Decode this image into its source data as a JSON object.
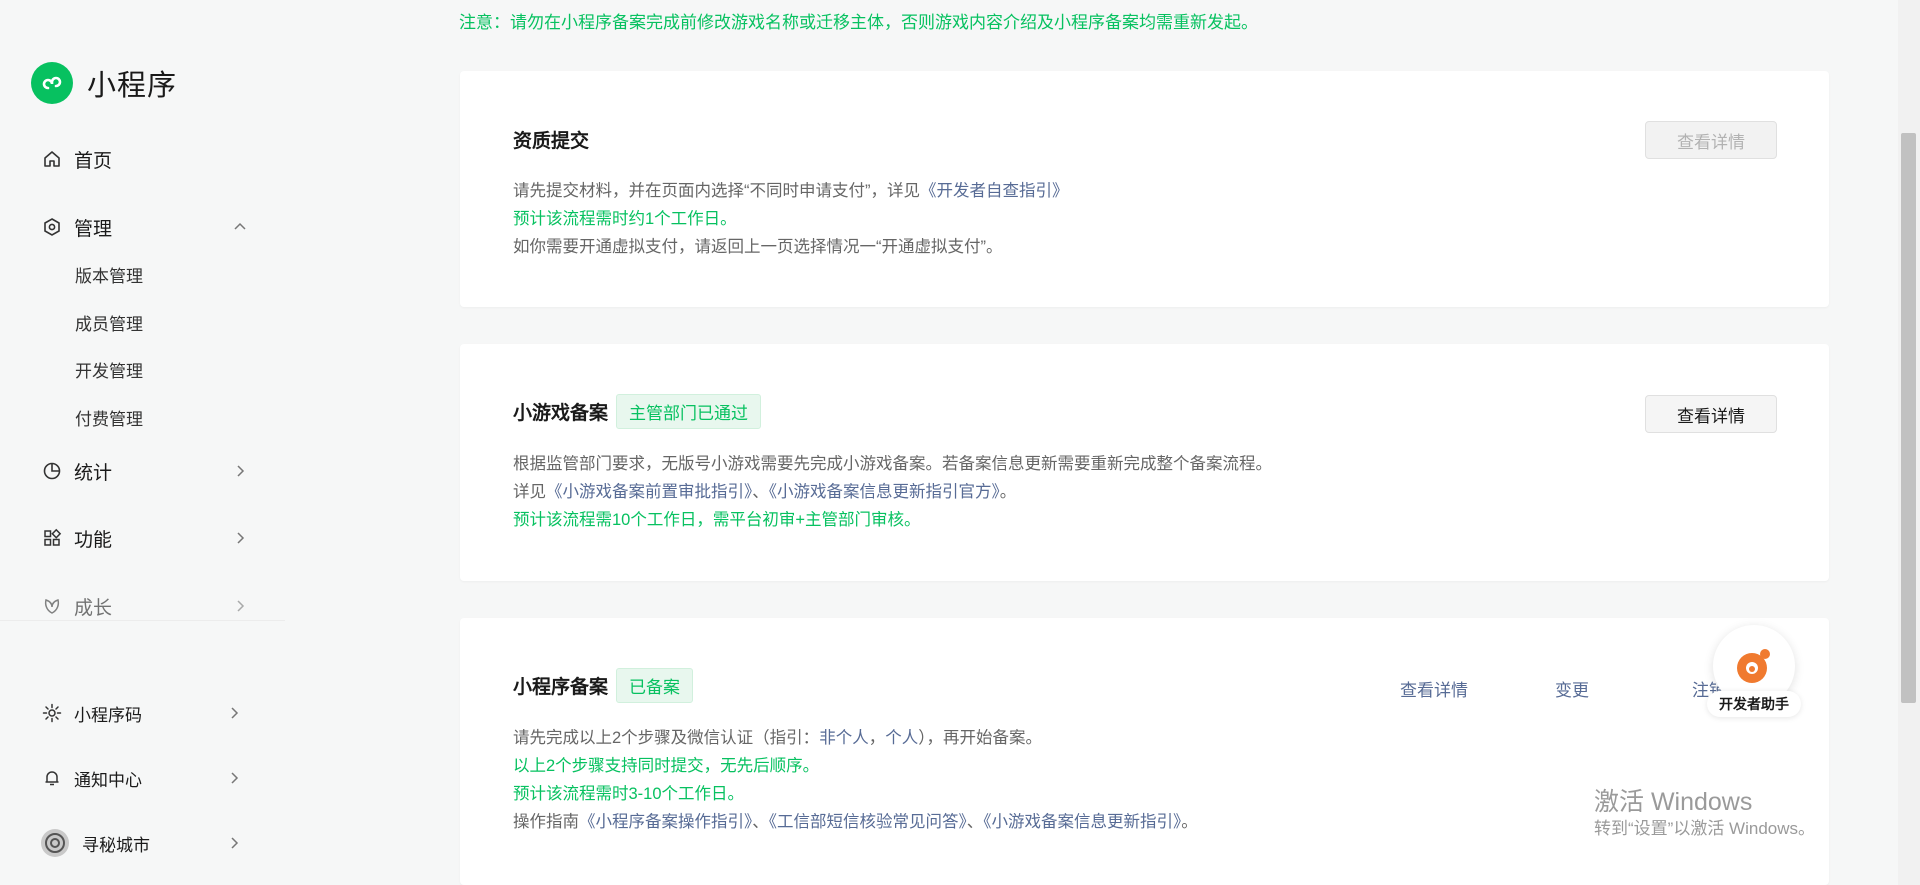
{
  "app": {
    "name": "小程序",
    "brand_color": "#07c160"
  },
  "sidebar": {
    "home": "首页",
    "manage": {
      "label": "管理",
      "children": [
        "版本管理",
        "成员管理",
        "开发管理",
        "付费管理"
      ]
    },
    "stats": "统计",
    "features": "功能",
    "growth": "成长",
    "qrcode": "小程序码",
    "notifications": "通知中心",
    "account": "寻秘城市"
  },
  "notice": "注意：请勿在小程序备案完成前修改游戏名称或迁移主体，否则游戏内容介绍及小程序备案均需重新发起。",
  "cards": {
    "qualification": {
      "title": "资质提交",
      "button": "查看详情",
      "line1_prefix": "请先提交材料，并在页面内选择“不同时申请支付”，详见",
      "line1_link": "《开发者自查指引》",
      "line2": "预计该流程需时约1个工作日。",
      "line3": "如你需要开通虚拟支付，请返回上一页选择情况一“开通虚拟支付”。"
    },
    "game_filing": {
      "title": "小游戏备案",
      "tag": "主管部门已通过",
      "button": "查看详情",
      "line1": "根据监管部门要求，无版号小游戏需要先完成小游戏备案。若备案信息更新需要重新完成整个备案流程。",
      "line2_prefix": "详见",
      "line2_link1": "《小游戏备案前置审批指引》",
      "line2_sep": "、",
      "line2_link2": "《小游戏备案信息更新指引官方》",
      "line2_suffix": "。",
      "line3": "预计该流程需10个工作日，需平台初审+主管部门审核。"
    },
    "app_filing": {
      "title": "小程序备案",
      "tag": "已备案",
      "actions": [
        "查看详情",
        "变更",
        "注销"
      ],
      "line1_prefix": "请先完成以上2个步骤及微信认证（指引：",
      "line1_link1": "非个人",
      "line1_sep": "，",
      "line1_link2": "个人",
      "line1_suffix": "），再开始备案。",
      "line2": "以上2个步骤支持同时提交，无先后顺序。",
      "line3": "预计该流程需时3-10个工作日。",
      "line4_prefix": "操作指南",
      "line4_link1": "《小程序备案操作指引》",
      "line4_sep1": "、",
      "line4_link2": "《工信部短信核验常见问答》",
      "line4_sep2": "、",
      "line4_link3": "《小游戏备案信息更新指引》",
      "line4_suffix": "。"
    }
  },
  "helper": {
    "label": "开发者助手"
  },
  "watermark": {
    "title": "激活 Windows",
    "subtitle": "转到“设置”以激活 Windows。"
  }
}
